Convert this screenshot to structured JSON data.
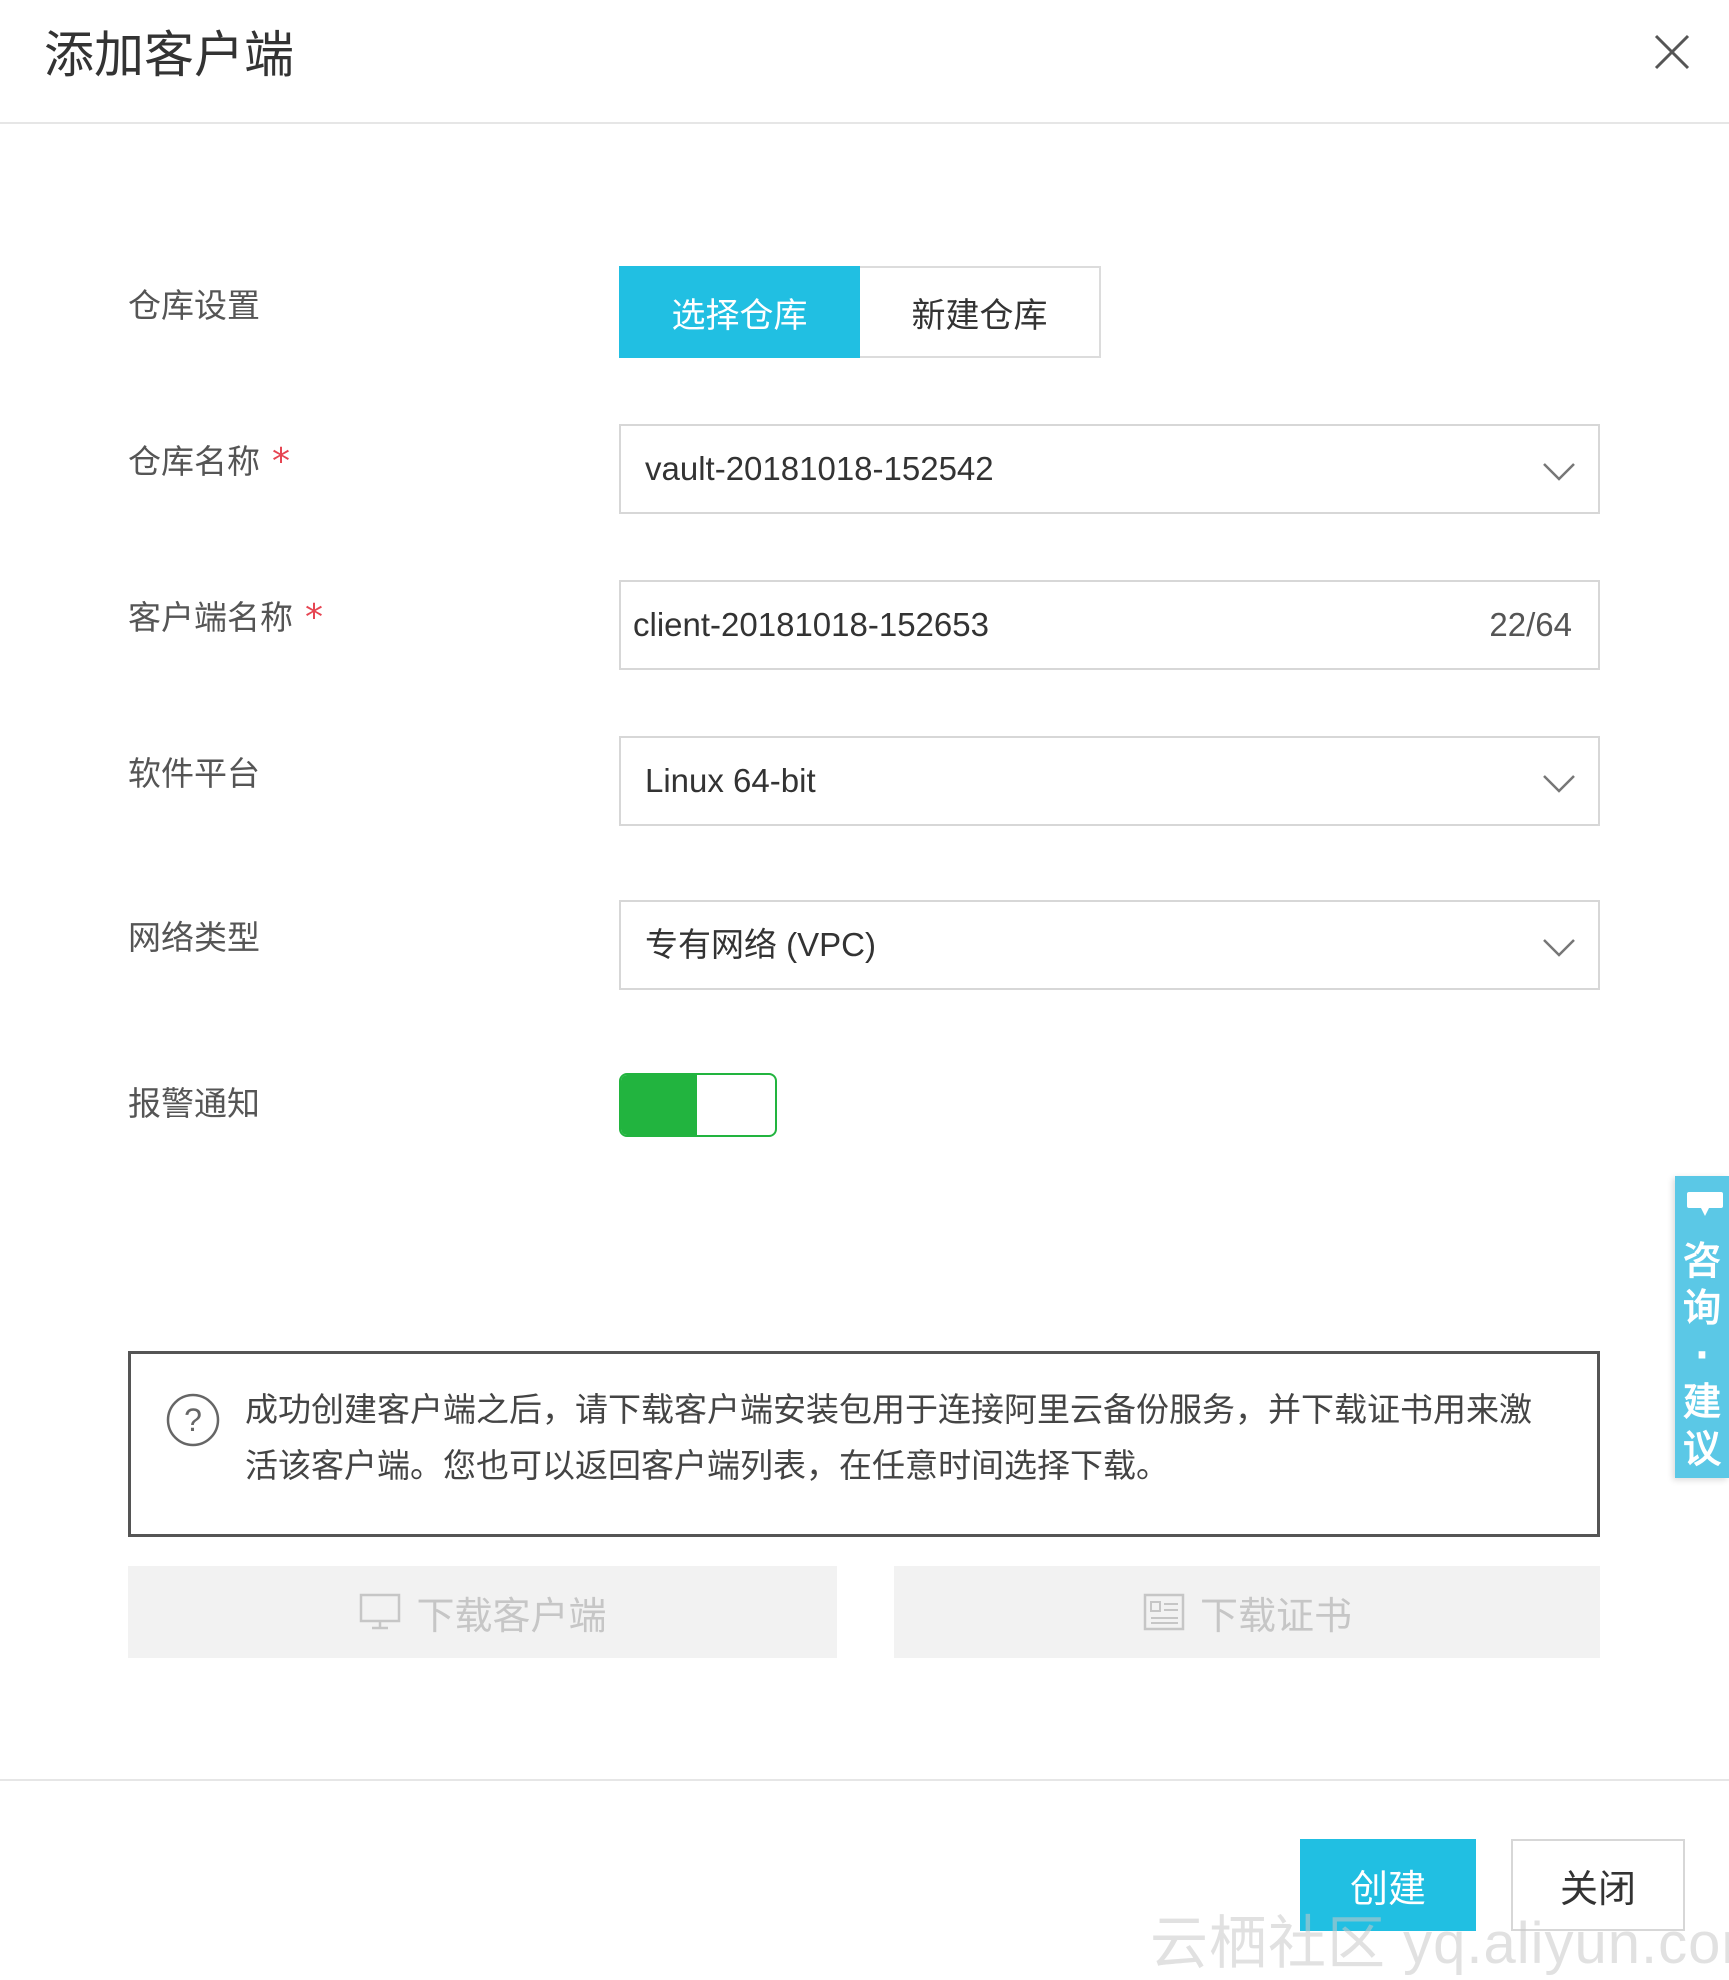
{
  "dialog": {
    "title": "添加客户端"
  },
  "form": {
    "vault_setting": {
      "label": "仓库设置",
      "options": [
        "选择仓库",
        "新建仓库"
      ],
      "selected": "选择仓库"
    },
    "vault_name": {
      "label": "仓库名称",
      "required_mark": "*",
      "value": "vault-20181018-152542"
    },
    "client_name": {
      "label": "客户端名称",
      "required_mark": "*",
      "value": "client-20181018-152653",
      "counter": "22/64"
    },
    "platform": {
      "label": "软件平台",
      "value": "Linux 64-bit"
    },
    "network": {
      "label": "网络类型",
      "value": "专有网络 (VPC)"
    },
    "alert": {
      "label": "报警通知",
      "enabled": true
    }
  },
  "info": {
    "icon": "question-icon",
    "text": "成功创建客户端之后，请下载客户端安装包用于连接阿里云备份服务，并下载证书用来激活该客户端。您也可以返回客户端列表，在任意时间选择下载。"
  },
  "downloads": {
    "client_label": "下载客户端",
    "client_icon": "monitor-icon",
    "cert_label": "下载证书",
    "cert_icon": "certificate-icon"
  },
  "footer": {
    "create_label": "创建",
    "close_label": "关闭"
  },
  "side_tab": {
    "label": "咨询·建议",
    "chars": [
      "咨",
      "询",
      "·",
      "建",
      "议"
    ]
  },
  "watermark": "云栖社区 yq.aliyun.com",
  "colors": {
    "accent": "#21bfe2",
    "toggle_on": "#22b43f",
    "required": "#e64552",
    "side_tab": "#5bc8e6"
  }
}
